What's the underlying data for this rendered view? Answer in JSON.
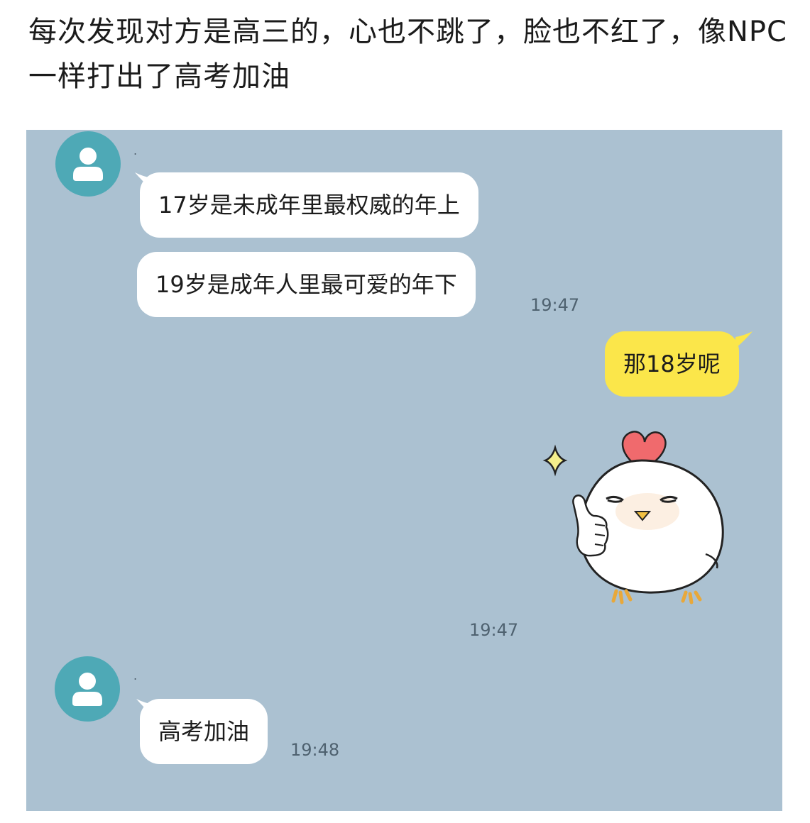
{
  "post": {
    "caption": "每次发现对方是高三的，心也不跳了，脸也不红了，像NPC一样打出了高考加油"
  },
  "chat": {
    "messages": [
      {
        "sender": "other",
        "name": ".",
        "text": "17岁是未成年里最权威的年上"
      },
      {
        "sender": "other",
        "text": "19岁是成年人里最可爱的年下",
        "time": "19:47"
      },
      {
        "sender": "me",
        "text": "那18岁呢"
      },
      {
        "sender": "me",
        "type": "sticker",
        "sticker": "chick-thumbs-up-heart-sticker",
        "time": "19:47"
      },
      {
        "sender": "other",
        "name": ".",
        "text": "高考加油",
        "time": "19:48"
      }
    ]
  },
  "colors": {
    "chat_background": "#abc1d1",
    "incoming_bubble": "#ffffff",
    "outgoing_bubble": "#fbe64a",
    "avatar": "#4ea9b6"
  }
}
